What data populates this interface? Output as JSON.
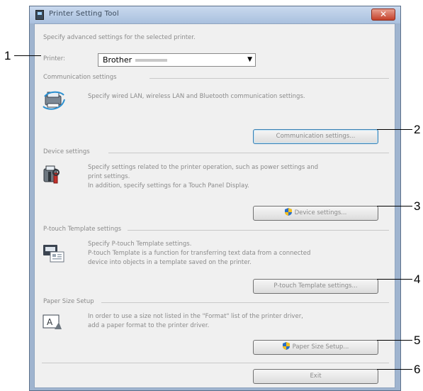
{
  "window": {
    "title": "Printer Setting Tool",
    "close_label": "✕"
  },
  "intro": "Specify advanced settings for the selected printer.",
  "printer": {
    "label": "Printer:",
    "value": "Brother",
    "arrow": "▼"
  },
  "sections": [
    {
      "title": "Communication settings",
      "description": [
        "Specify wired LAN, wireless LAN and Bluetooth communication settings."
      ],
      "button": "Communication settings...",
      "icon": "network-printer-icon"
    },
    {
      "title": "Device settings",
      "description": [
        "Specify settings related to the printer operation, such as power settings and",
        "print settings.",
        "In addition, specify settings for a Touch Panel Display."
      ],
      "button": "Device settings...",
      "icon": "device-tools-icon"
    },
    {
      "title": "P-touch Template settings",
      "description": [
        "Specify P-touch Template settings.",
        "P-touch Template is a function for transferring text data from a connected",
        "device into objects in a template saved on the printer."
      ],
      "button": "P-touch Template settings...",
      "icon": "template-icon"
    },
    {
      "title": "Paper Size Setup",
      "description": [
        "In order to use a size not listed in the \"Format\" list of the printer driver,",
        "add a paper format to the printer driver."
      ],
      "button": "Paper Size Setup...",
      "icon": "paper-size-icon"
    }
  ],
  "exit_button": "Exit",
  "callouts": [
    "1",
    "2",
    "3",
    "4",
    "5",
    "6"
  ]
}
